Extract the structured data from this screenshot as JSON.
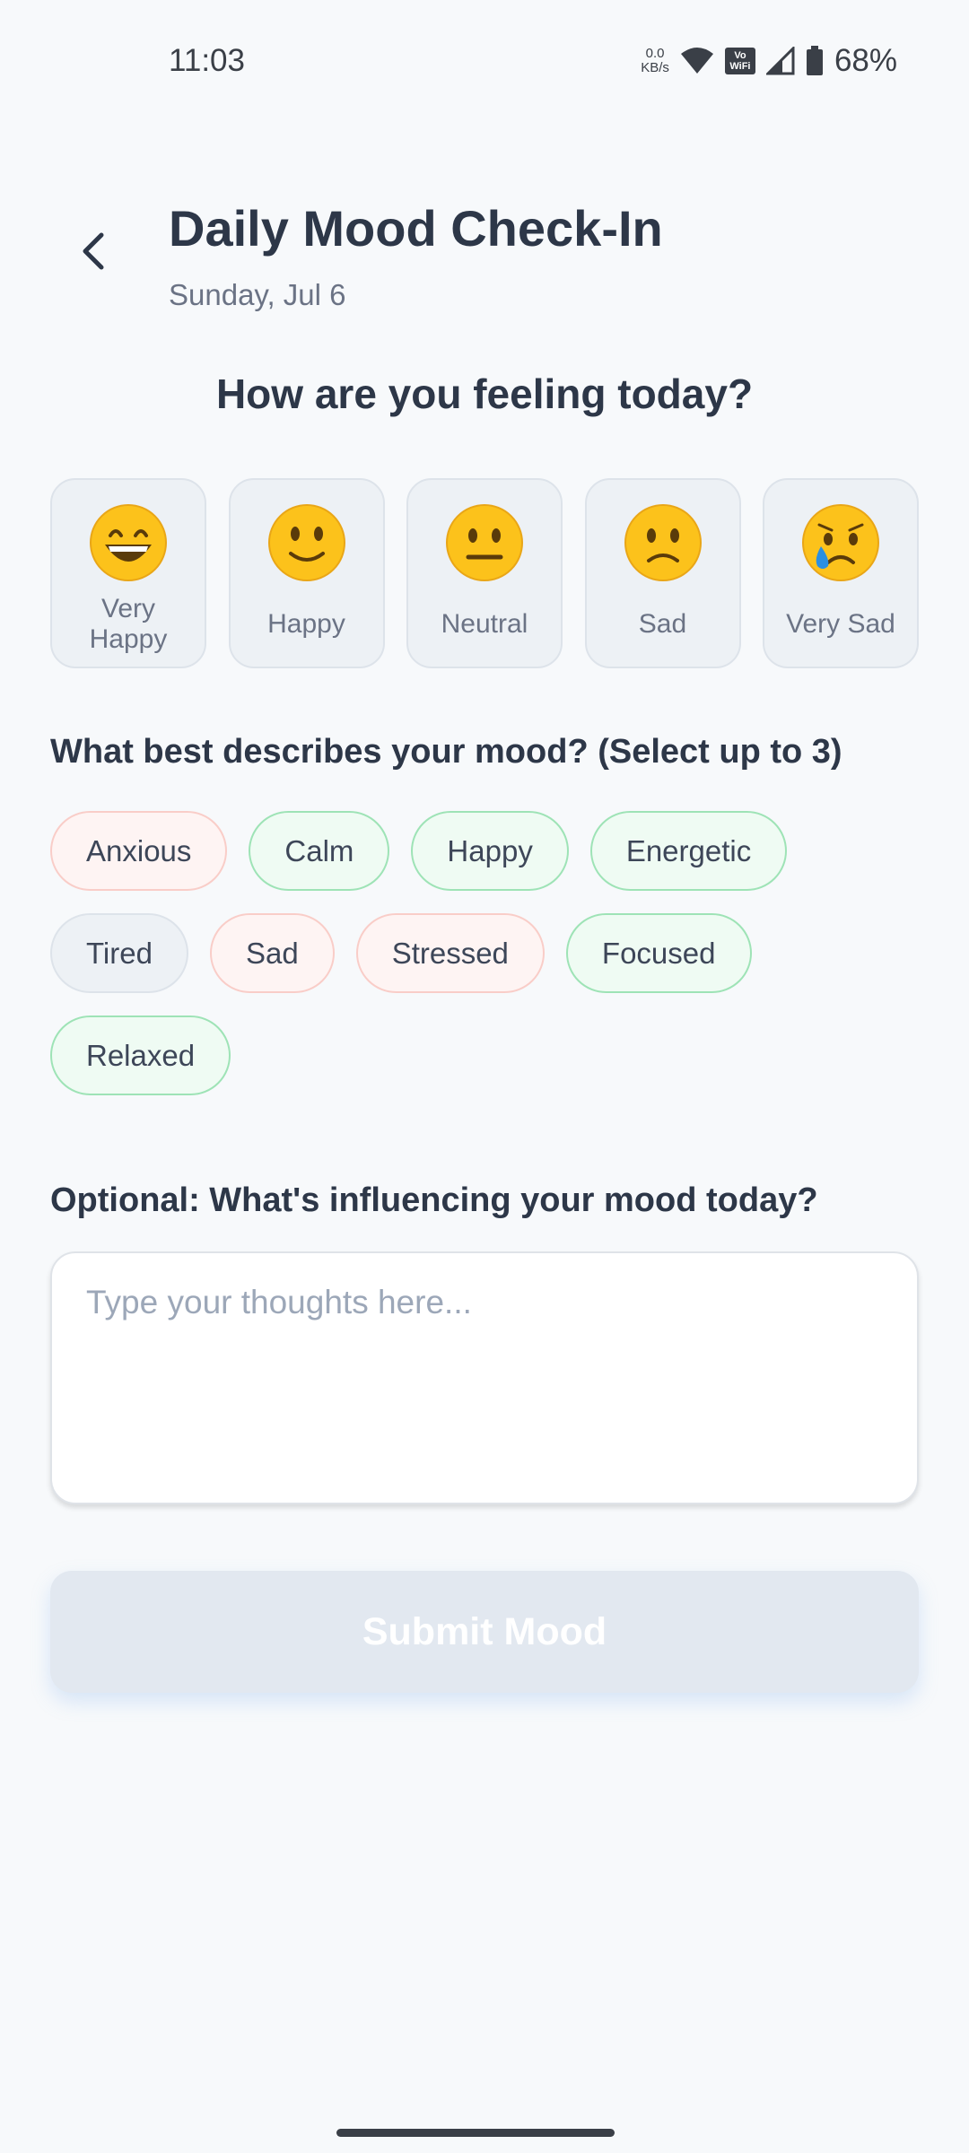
{
  "status_bar": {
    "time": "11:03",
    "net_speed_value": "0.0",
    "net_speed_unit": "KB/s",
    "vowifi_top": "Vo",
    "vowifi_bottom": "WiFi",
    "battery": "68%"
  },
  "header": {
    "title": "Daily Mood Check-In",
    "date": "Sunday, Jul 6"
  },
  "mood_question": "How are you feeling today?",
  "moods": [
    {
      "label": "Very Happy",
      "icon": "grinning-face-icon"
    },
    {
      "label": "Happy",
      "icon": "slightly-smiling-face-icon"
    },
    {
      "label": "Neutral",
      "icon": "neutral-face-icon"
    },
    {
      "label": "Sad",
      "icon": "slightly-frowning-face-icon"
    },
    {
      "label": "Very Sad",
      "icon": "crying-face-icon"
    }
  ],
  "describe_label": "What best describes your mood? (Select up to 3)",
  "tags": [
    {
      "label": "Anxious",
      "tone": "negative"
    },
    {
      "label": "Calm",
      "tone": "positive"
    },
    {
      "label": "Happy",
      "tone": "positive"
    },
    {
      "label": "Energetic",
      "tone": "positive"
    },
    {
      "label": "Tired",
      "tone": "neutral"
    },
    {
      "label": "Sad",
      "tone": "negative"
    },
    {
      "label": "Stressed",
      "tone": "negative"
    },
    {
      "label": "Focused",
      "tone": "positive"
    },
    {
      "label": "Relaxed",
      "tone": "positive"
    }
  ],
  "influence_label": "Optional: What's influencing your mood today?",
  "thoughts": {
    "value": "",
    "placeholder": "Type your thoughts here..."
  },
  "submit_label": "Submit Mood",
  "colors": {
    "background": "#f7f9fb",
    "text_primary": "#2d3748",
    "tag_negative_bg": "#fef4f3",
    "tag_negative_border": "#f9cdc8",
    "tag_positive_bg": "#effbf3",
    "tag_positive_border": "#9ee3b6",
    "tag_neutral_bg": "#edf1f5",
    "submit_disabled_bg": "#e2e8f0"
  }
}
